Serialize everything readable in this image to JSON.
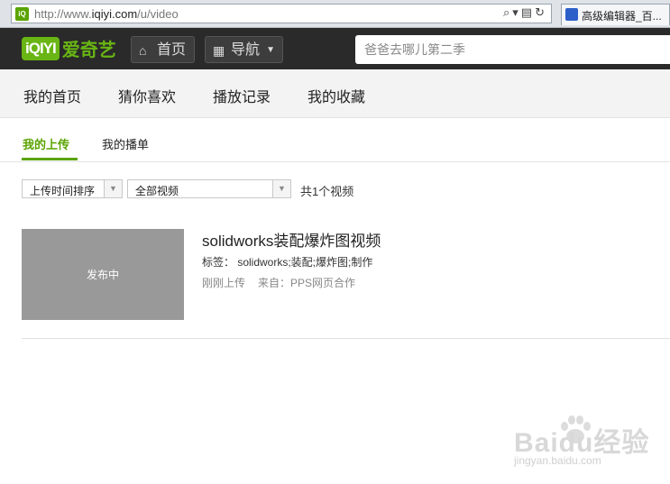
{
  "browser": {
    "url_prefix": "http://www.",
    "url_domain": "iqiyi.com",
    "url_path": "/u/video",
    "tab_title": "高级编辑器_百..."
  },
  "header": {
    "logo_mark": "iQIYI",
    "logo_text": "爱奇艺",
    "home_label": "首页",
    "guide_label": "导航",
    "search_placeholder": "爸爸去哪儿第二季"
  },
  "subnav": {
    "items": [
      "我的首页",
      "猜你喜欢",
      "播放记录",
      "我的收藏"
    ]
  },
  "tabs": {
    "items": [
      "我的上传",
      "我的播单"
    ],
    "active_index": 0
  },
  "filters": {
    "sort_value": "上传时间排序",
    "category_value": "全部视频",
    "count_text": "共1个视频"
  },
  "videos": [
    {
      "status": "发布中",
      "title": "solidworks装配爆炸图视频",
      "tags": "标签： solidworks;装配;爆炸图;制作",
      "time": "刚刚上传",
      "source": "来自：PPS网页合作"
    }
  ],
  "watermark": {
    "text": "Baidu经验",
    "site": "jingyan.baidu.com"
  },
  "colors": {
    "brand_green": "#5aa400",
    "header_bg": "#2a2a2a",
    "thumb_bg": "#999999"
  }
}
